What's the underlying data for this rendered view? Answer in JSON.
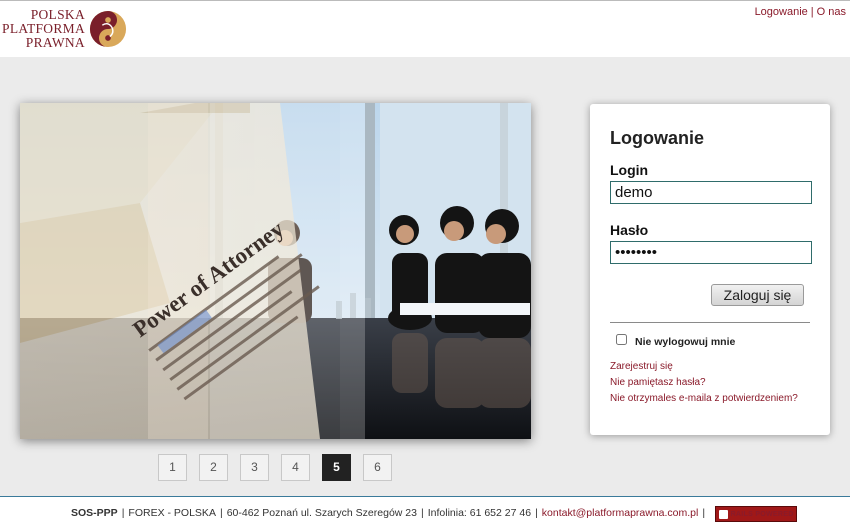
{
  "brand": {
    "line1": "POLSKA",
    "line2": "PLATFORMA",
    "line3": "PRAWNA",
    "color": "#7a1f2a",
    "accent": "#d9a85a"
  },
  "topnav": {
    "login_label": "Logowanie",
    "separator": "|",
    "about_label": "O nas"
  },
  "hero": {
    "document_text": "Power of Attorney"
  },
  "pager": {
    "pages": [
      "1",
      "2",
      "3",
      "4",
      "5",
      "6"
    ],
    "active": "5"
  },
  "login": {
    "title": "Logowanie",
    "login_label": "Login",
    "login_value": "demo",
    "password_label": "Hasło",
    "password_value": "••••••••",
    "submit_label": "Zaloguj się",
    "remember_label": "Nie wylogowuj mnie",
    "links": [
      "Zarejestruj się",
      "Nie pamiętasz hasła?",
      "Nie otrzymales e-maila z potwierdzeniem?"
    ]
  },
  "footer": {
    "company": "SOS-PPP",
    "sep": "|",
    "part1": "FOREX - POLSKA",
    "part2": "60-462 Poznań ul. Szarych Szeregów 23",
    "part3": "Infolinia: 61 652 27 46",
    "email": "kontakt@platformaprawna.com.pl",
    "badge": "RAILS POWERED"
  }
}
